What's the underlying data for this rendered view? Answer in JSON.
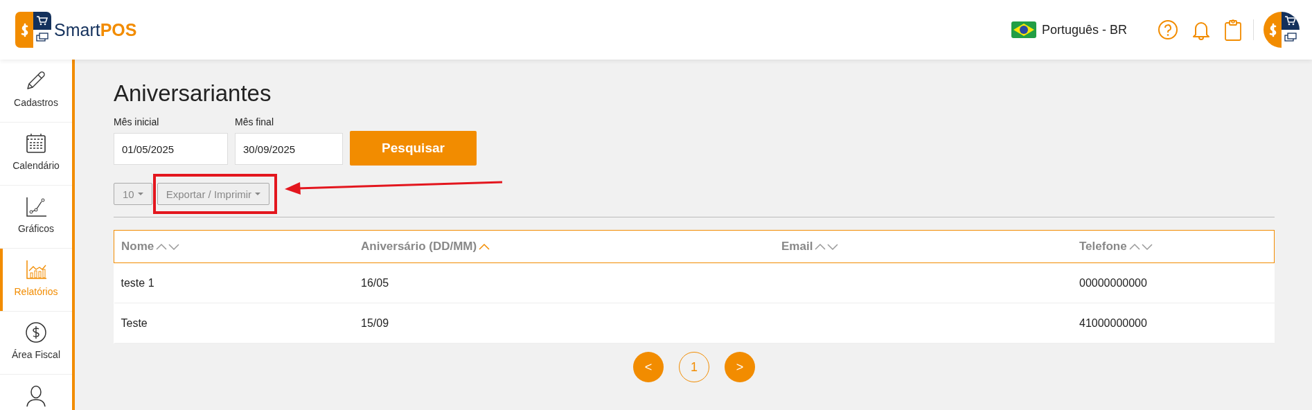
{
  "header": {
    "brand": {
      "first": "Smart",
      "second": "POS"
    },
    "language": "Português - BR"
  },
  "sidebar": {
    "items": [
      {
        "label": "Cadastros",
        "selected": false
      },
      {
        "label": "Calendário",
        "selected": false
      },
      {
        "label": "Gráficos",
        "selected": false
      },
      {
        "label": "Relatórios",
        "selected": true
      },
      {
        "label": "Área Fiscal",
        "selected": false
      },
      {
        "selected": false
      }
    ]
  },
  "page": {
    "title": "Aniversariantes",
    "filters": [
      {
        "label": "Mês inicial",
        "value": "01/05/2025"
      },
      {
        "label": "Mês final",
        "value": "30/09/2025"
      }
    ],
    "search_button": "Pesquisar",
    "page_size": "10",
    "export_button": "Exportar / Imprimir"
  },
  "table": {
    "columns": [
      {
        "label": "Nome",
        "sorted": false
      },
      {
        "label": "Aniversário (DD/MM)",
        "sorted": true
      },
      {
        "label": "Email",
        "sorted": false
      },
      {
        "label": "Telefone",
        "sorted": false
      }
    ],
    "rows": [
      {
        "name": "teste 1",
        "birthday": "16/05",
        "phone": "00000000000"
      },
      {
        "name": "Teste",
        "birthday": "15/09",
        "phone": "41000000000"
      }
    ]
  },
  "pagination": {
    "prev": "<",
    "pages": [
      {
        "label": "1",
        "selected": true
      }
    ],
    "next": ">"
  }
}
